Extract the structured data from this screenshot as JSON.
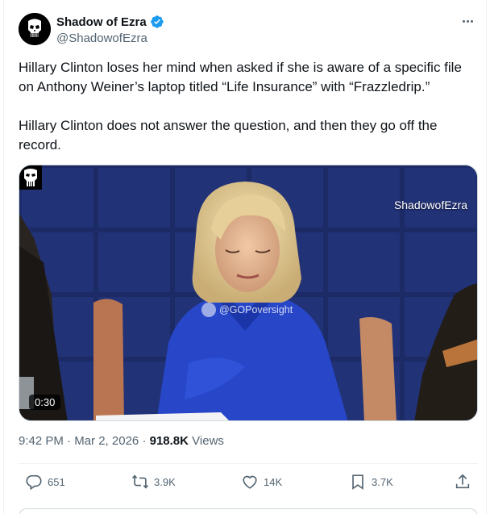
{
  "author": {
    "display_name": "Shadow of Ezra",
    "handle": "@ShadowofEzra",
    "verified": true,
    "avatar_icon": "punisher-skull-icon"
  },
  "tweet": {
    "paragraph1": "Hillary Clinton loses her mind when asked if she is aware of a specific file on Anthony Weiner’s laptop titled “Life Insurance” with “Frazzledrip.”",
    "paragraph2": "Hillary Clinton does not answer the question, and then they go off the record."
  },
  "media": {
    "watermark": "ShadowofEzra",
    "overlay_tag": "@GOPoversight",
    "duration": "0:30"
  },
  "meta": {
    "time": "9:42 PM",
    "separator": "·",
    "date": "Mar 2, 2026",
    "views_count": "918.8K",
    "views_label": "Views"
  },
  "actions": {
    "replies": "651",
    "reposts": "3.9K",
    "likes": "14K",
    "bookmarks": "3.7K"
  },
  "colors": {
    "text_primary": "#0f1419",
    "text_secondary": "#536471",
    "verified_blue": "#1d9bf0",
    "border": "#eff3f4"
  }
}
